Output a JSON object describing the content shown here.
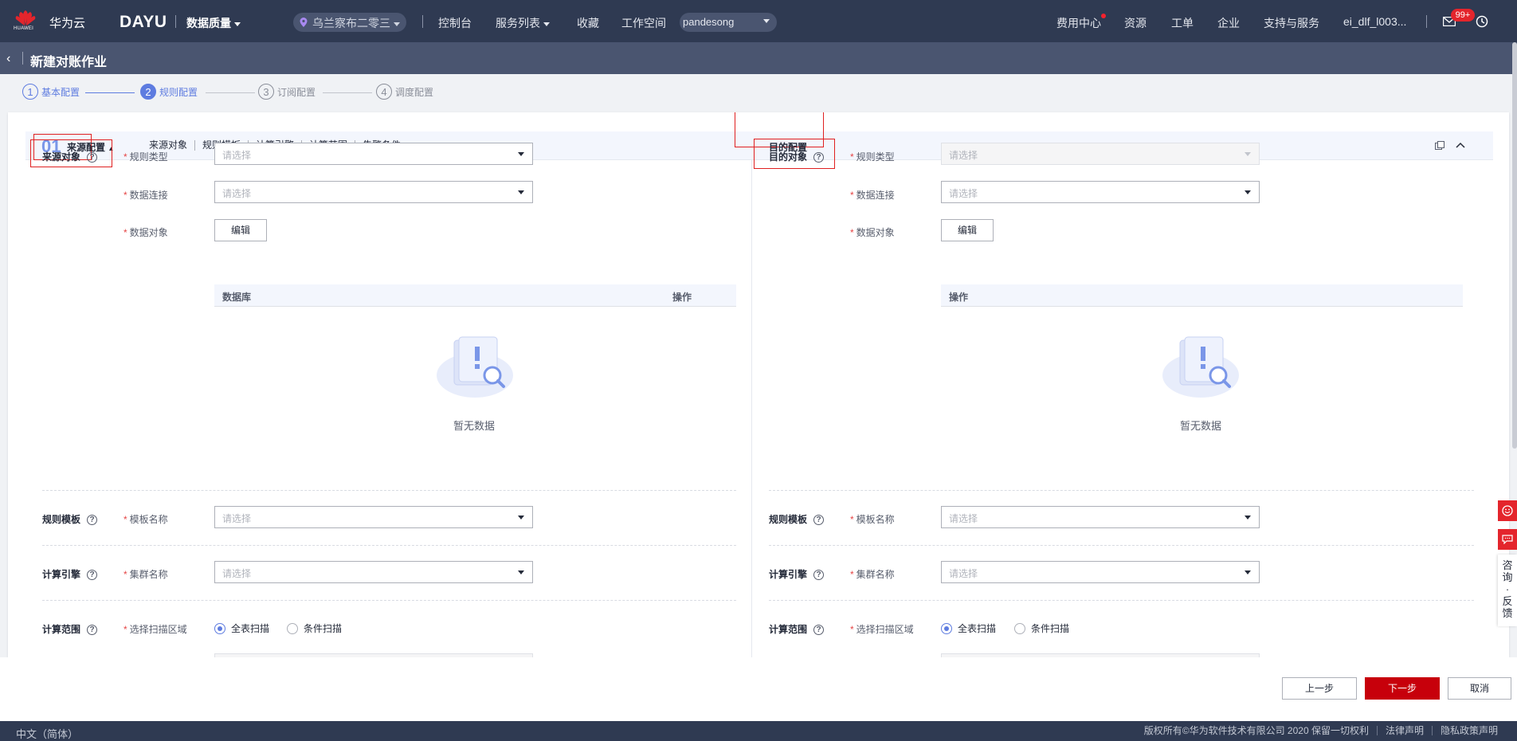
{
  "topbar": {
    "logo_sub": "HUAWEI",
    "brand": "华为云",
    "product": "DAYU",
    "module": "数据质量",
    "region": "乌兰察布二零三",
    "nav": [
      "控制台",
      "服务列表",
      "收藏",
      "工作空间"
    ],
    "project": "pandesong",
    "right_nav": [
      "费用中心",
      "资源",
      "工单",
      "企业",
      "支持与服务"
    ],
    "user": "ei_dlf_l003...",
    "badge": "99+",
    "accent": "#2f3a52"
  },
  "titlebar": {
    "title": "新建对账作业"
  },
  "steps": [
    {
      "num": "1",
      "label": "基本配置",
      "state": "done"
    },
    {
      "num": "2",
      "label": "规则配置",
      "state": "active"
    },
    {
      "num": "3",
      "label": "订阅配置",
      "state": "todo"
    },
    {
      "num": "4",
      "label": "调度配置",
      "state": "todo"
    }
  ],
  "source": {
    "index": "01",
    "title": "来源配置",
    "anchors": [
      "来源对象",
      "规则模板",
      "计算引擎",
      "计算范围",
      "告警条件"
    ],
    "object_label": "来源对象",
    "rule_type_label": "规则类型",
    "conn_label": "数据连接",
    "dataobj_label": "数据对象",
    "placeholder": "请选择",
    "edit_btn": "编辑",
    "table_cols": [
      "数据库",
      "操作"
    ],
    "empty_text": "暂无数据",
    "template_section": "规则模板",
    "template_label": "模板名称",
    "engine_section": "计算引擎",
    "cluster_label": "集群名称",
    "range_section": "计算范围",
    "scan_label": "选择扫描区域",
    "scan_opts": [
      "全表扫描",
      "条件扫描"
    ]
  },
  "target": {
    "title": "目的配置",
    "object_label": "目的对象",
    "rule_type_label": "规则类型",
    "conn_label": "数据连接",
    "dataobj_label": "数据对象",
    "placeholder": "请选择",
    "edit_btn": "编辑",
    "table_cols": [
      "操作"
    ],
    "empty_text": "暂无数据",
    "template_section": "规则模板",
    "template_label": "模板名称",
    "engine_section": "计算引擎",
    "cluster_label": "集群名称",
    "range_section": "计算范围",
    "scan_label": "选择扫描区域",
    "scan_opts": [
      "全表扫描",
      "条件扫描"
    ]
  },
  "actions": {
    "prev": "上一步",
    "next": "下一步",
    "cancel": "取消"
  },
  "footer": {
    "lang": "中文（简体）",
    "links": [
      "版权所有©华为软件技术有限公司 2020 保留一切权利",
      "法律声明",
      "隐私政策声明"
    ]
  },
  "side": {
    "feedback": [
      "咨",
      "询",
      "·",
      "反",
      "馈"
    ]
  }
}
